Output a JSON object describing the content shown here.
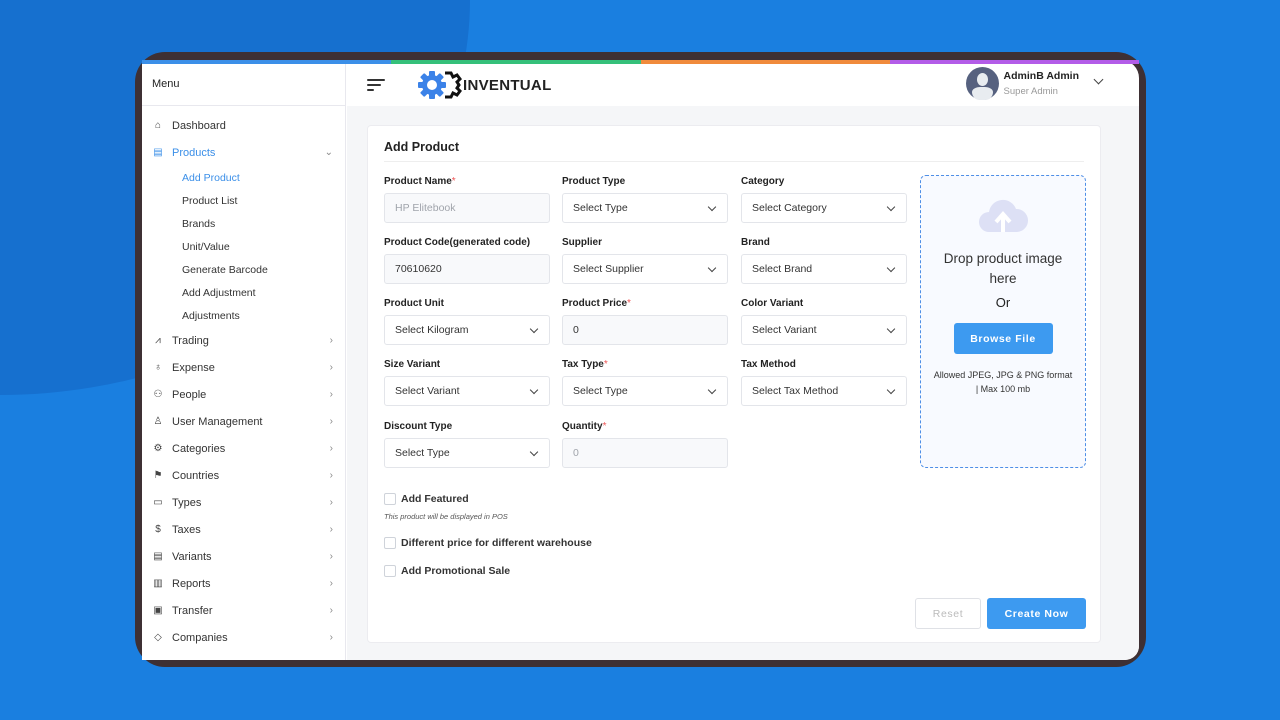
{
  "colors": {
    "accent": "#3d9af0",
    "strip": [
      "#3b8fe8",
      "#35c07a",
      "#f08a3c",
      "#b35ce8"
    ]
  },
  "sidebar": {
    "menu_title": "Menu",
    "items": [
      {
        "label": "Dashboard",
        "icon": "home-icon",
        "glyph": "⌂"
      },
      {
        "label": "Products",
        "icon": "list-icon",
        "glyph": "▤",
        "active": true,
        "expanded": true,
        "children": [
          "Add Product",
          "Product List",
          "Brands",
          "Unit/Value",
          "Generate Barcode",
          "Add Adjustment",
          "Adjustments"
        ]
      },
      {
        "label": "Trading",
        "icon": "chart-icon",
        "glyph": "⩘"
      },
      {
        "label": "Expense",
        "icon": "money-bag-icon",
        "glyph": "♁"
      },
      {
        "label": "People",
        "icon": "people-icon",
        "glyph": "⚇"
      },
      {
        "label": "User Management",
        "icon": "user-icon",
        "glyph": "♙"
      },
      {
        "label": "Categories",
        "icon": "categories-icon",
        "glyph": "⚙"
      },
      {
        "label": "Countries",
        "icon": "map-icon",
        "glyph": "⚑"
      },
      {
        "label": "Types",
        "icon": "box-icon",
        "glyph": "▭"
      },
      {
        "label": "Taxes",
        "icon": "dollar-icon",
        "glyph": "$"
      },
      {
        "label": "Variants",
        "icon": "document-icon",
        "glyph": "▤"
      },
      {
        "label": "Reports",
        "icon": "reports-icon",
        "glyph": "▥"
      },
      {
        "label": "Transfer",
        "icon": "bus-icon",
        "glyph": "▣"
      },
      {
        "label": "Companies",
        "icon": "tag-icon",
        "glyph": "◇"
      }
    ],
    "active_child": "Add Product"
  },
  "header": {
    "brand": "INVENTUAL",
    "user_name": "AdminB Admin",
    "user_role": "Super Admin"
  },
  "form": {
    "title": "Add Product",
    "fields": [
      {
        "label": "Product Name",
        "required": true,
        "value": "HP Elitebook",
        "placeholder": true,
        "select": false
      },
      {
        "label": "Product Type",
        "required": false,
        "value": "Select Type",
        "select": true
      },
      {
        "label": "Category",
        "required": false,
        "value": "Select Category",
        "select": true
      },
      {
        "label": "Product Code(generated code)",
        "required": false,
        "value": "70610620",
        "select": false
      },
      {
        "label": "Supplier",
        "required": false,
        "value": "Select Supplier",
        "select": true
      },
      {
        "label": "Brand",
        "required": false,
        "value": "Select Brand",
        "select": true
      },
      {
        "label": "Product Unit",
        "required": false,
        "value": "Select Kilogram",
        "select": true
      },
      {
        "label": "Product Price",
        "required": true,
        "value": "0",
        "select": false
      },
      {
        "label": "Color Variant",
        "required": false,
        "value": "Select Variant",
        "select": true
      },
      {
        "label": "Size Variant",
        "required": false,
        "value": "Select Variant",
        "select": true
      },
      {
        "label": "Tax Type",
        "required": true,
        "value": "Select Type",
        "select": true
      },
      {
        "label": "Tax Method",
        "required": false,
        "value": "Select Tax Method",
        "select": true
      },
      {
        "label": "Discount Type",
        "required": false,
        "value": "Select Type",
        "select": true
      },
      {
        "label": "Quantity",
        "required": true,
        "value": "0",
        "placeholder": true,
        "select": false
      }
    ],
    "upload": {
      "text": "Drop product image here",
      "or": "Or",
      "button": "Browse File",
      "note": "Allowed JPEG, JPG & PNG format | Max 100 mb"
    },
    "checkboxes": [
      {
        "label": "Add Featured",
        "checked": false
      },
      {
        "label": "Different price for different warehouse",
        "checked": false
      },
      {
        "label": "Add Promotional Sale",
        "checked": false
      }
    ],
    "featured_hint": "This product will be displayed in POS",
    "reset": "Reset",
    "create": "Create Now"
  }
}
